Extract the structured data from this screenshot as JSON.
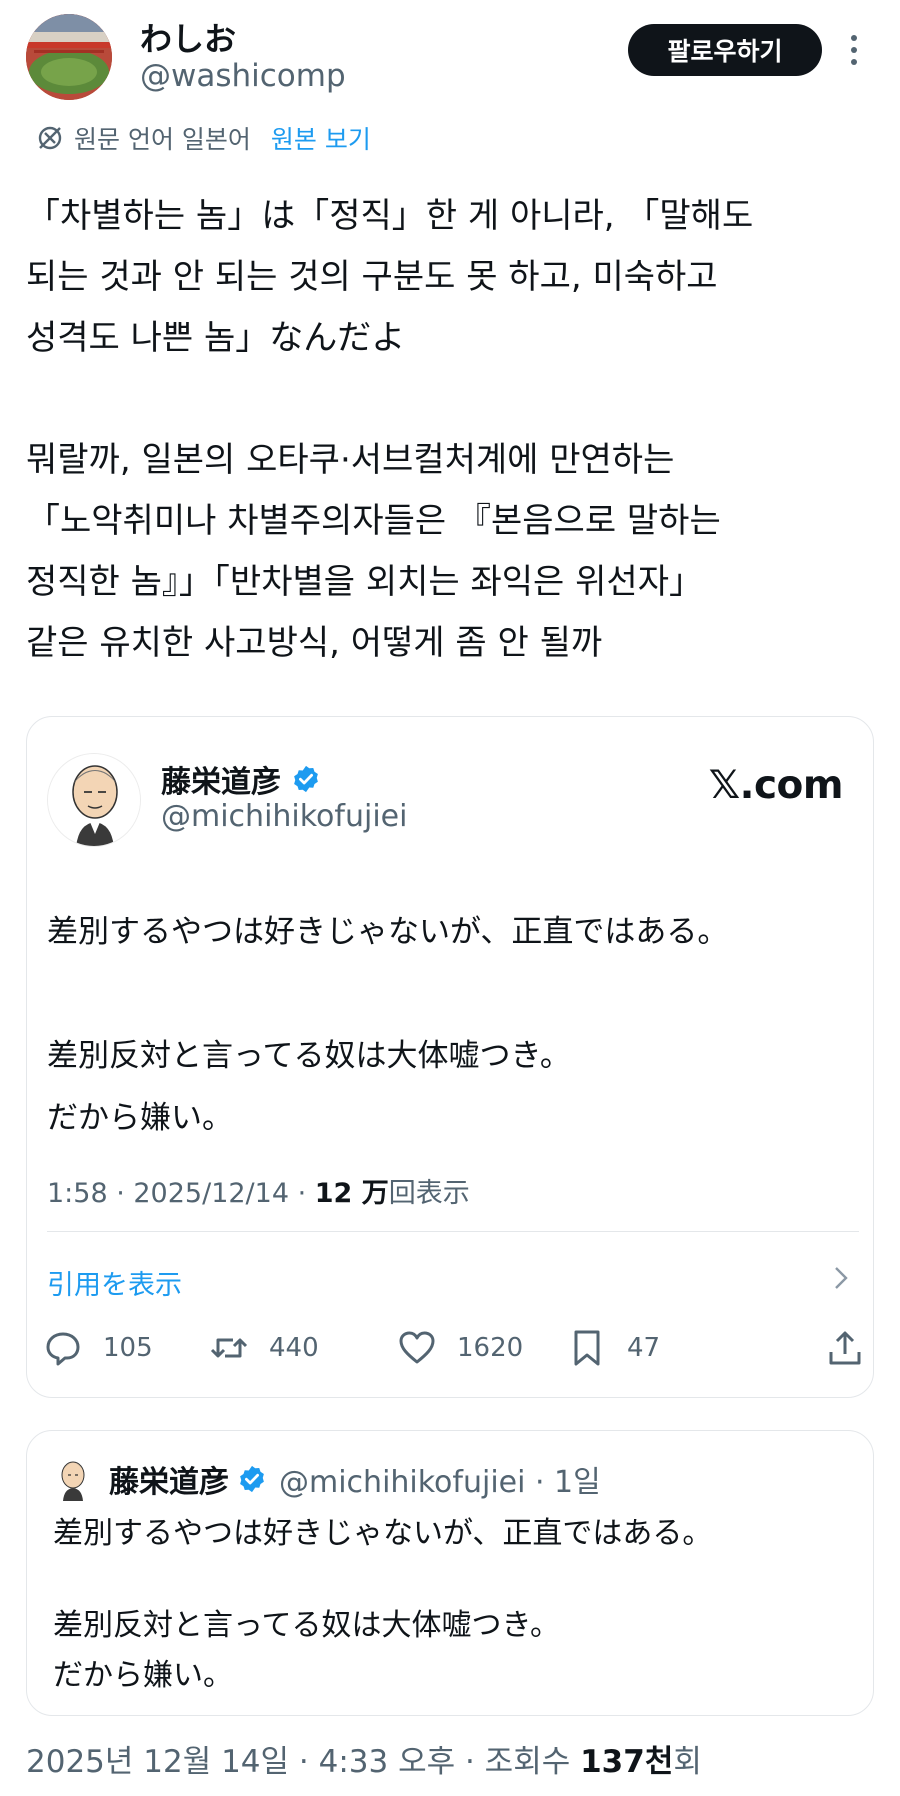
{
  "author": {
    "name": "わしお",
    "handle": "@washicomp",
    "avatar_icon": "stadium-avatar"
  },
  "follow_label": "팔로우하기",
  "translation": {
    "label": "원문 언어 일본어",
    "link": "원본 보기",
    "icon": "translate-off-icon"
  },
  "post": {
    "lines": [
      "「차별하는 놈」は「정직」한 게 아니라, 「말해도",
      "되는 것과 안 되는 것의 구분도 못 하고, 미숙하고",
      "성격도 나쁜 놈」なんだよ",
      "",
      "뭐랄까, 일본의 오타쿠·서브컬처계에 만연하는",
      "「노악취미나 차별주의자들은 『본음으로 말하는",
      "정직한 놈』」「반차별을 외치는 좌익은 위선자」",
      "같은 유치한 사고방식, 어떻게 좀 안 될까"
    ]
  },
  "card": {
    "name": "藤栄道彦",
    "handle": "@michihikofujiei",
    "site": "𝕏.com",
    "lines": [
      "差別するやつは好きじゃないが、正直ではある。",
      "",
      "差別反対と言ってる奴は大体嘘つき。",
      "だから嫌い。"
    ],
    "meta_prefix": "1:58 · 2025/12/14 · ",
    "views": "12 万",
    "views_suffix": "回表示",
    "quote_link": "引用を表示",
    "counts": {
      "replies": "105",
      "retweets": "440",
      "likes": "1620",
      "bookmarks": "47"
    }
  },
  "quote": {
    "name": "藤栄道彦",
    "handle": "@michihikofujiei · 1일",
    "lines": [
      "差別するやつは好きじゃないが、正直ではある。",
      "",
      "差別反対と言ってる奴は大体嘘つき。",
      "だから嫌い。"
    ]
  },
  "footer": {
    "prefix": "2025년 12월 14일 · 4:33 오후 · 조회수 ",
    "views": "137천",
    "suffix": "회"
  },
  "colors": {
    "accent": "#1d9bf0",
    "secondary_text": "#536471",
    "primary_text": "#0f1419"
  }
}
